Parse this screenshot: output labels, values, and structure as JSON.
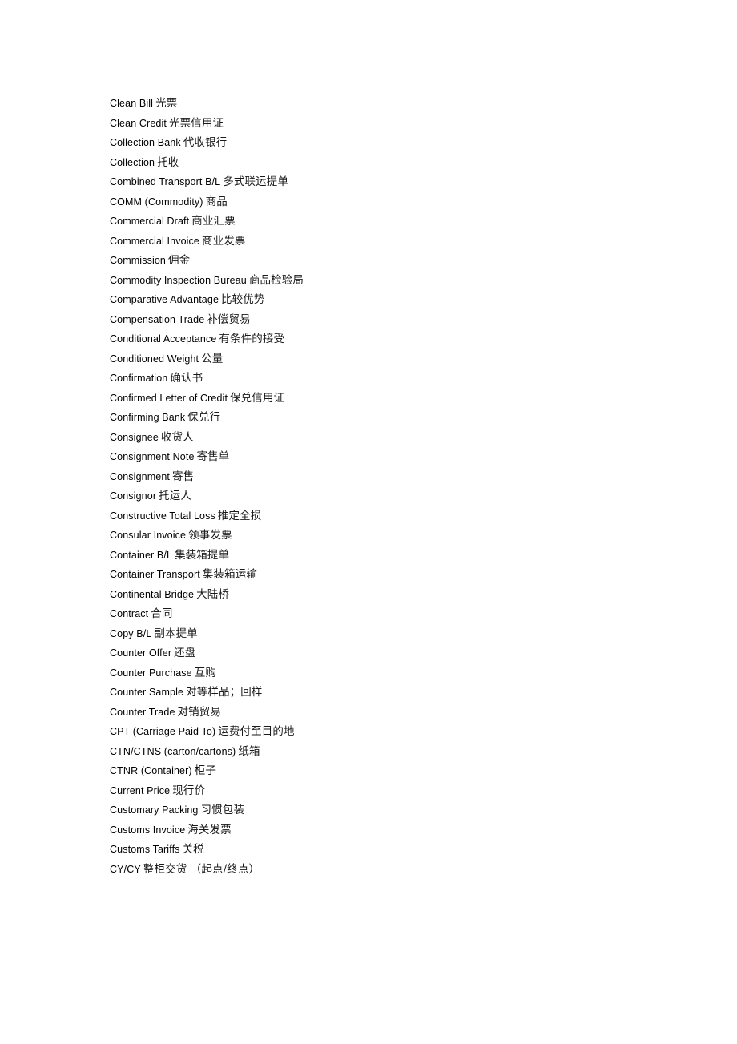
{
  "document": {
    "type": "glossary-page",
    "background_color": "#ffffff",
    "text_color": "#000000",
    "entries": [
      {
        "en": "Clean Bill",
        "zh": "光票"
      },
      {
        "en": "Clean Credit",
        "zh": "光票信用证"
      },
      {
        "en": "Collection Bank",
        "zh": "代收银行"
      },
      {
        "en": "Collection",
        "zh": "托收"
      },
      {
        "en": "Combined Transport B/L",
        "zh": "多式联运提单"
      },
      {
        "en": "COMM (Commodity)",
        "zh": "商品"
      },
      {
        "en": "Commercial Draft",
        "zh": "商业汇票"
      },
      {
        "en": "Commercial Invoice",
        "zh": "商业发票"
      },
      {
        "en": "Commission",
        "zh": "佣金"
      },
      {
        "en": "Commodity Inspection Bureau",
        "zh": "商品检验局"
      },
      {
        "en": "Comparative Advantage",
        "zh": "比较优势"
      },
      {
        "en": "Compensation Trade",
        "zh": "补偿贸易"
      },
      {
        "en": "Conditional Acceptance",
        "zh": "有条件的接受"
      },
      {
        "en": "Conditioned Weight",
        "zh": "公量"
      },
      {
        "en": "Confirmation",
        "zh": "确认书"
      },
      {
        "en": "Confirmed Letter of Credit",
        "zh": "保兑信用证"
      },
      {
        "en": "Confirming Bank",
        "zh": "保兑行"
      },
      {
        "en": "Consignee",
        "zh": "收货人"
      },
      {
        "en": "Consignment Note",
        "zh": "寄售单"
      },
      {
        "en": "Consignment",
        "zh": "寄售"
      },
      {
        "en": "Consignor",
        "zh": "托运人"
      },
      {
        "en": "Constructive Total Loss",
        "zh": "推定全损"
      },
      {
        "en": "Consular Invoice",
        "zh": "领事发票"
      },
      {
        "en": "Container B/L",
        "zh": "集装箱提单"
      },
      {
        "en": "Container Transport",
        "zh": "集装箱运输"
      },
      {
        "en": "Continental Bridge",
        "zh": "大陆桥"
      },
      {
        "en": "Contract",
        "zh": "合同"
      },
      {
        "en": "Copy B/L",
        "zh": "副本提单"
      },
      {
        "en": "Counter Offer",
        "zh": "还盘"
      },
      {
        "en": "Counter Purchase",
        "zh": "互购"
      },
      {
        "en": "Counter Sample",
        "zh": "对等样品；回样"
      },
      {
        "en": "Counter Trade",
        "zh": "对销贸易"
      },
      {
        "en": "CPT (Carriage Paid To)",
        "zh": "运费付至目的地"
      },
      {
        "en": "CTN/CTNS (carton/cartons)",
        "zh": "纸箱"
      },
      {
        "en": "CTNR (Container)",
        "zh": "柜子"
      },
      {
        "en": "Current Price",
        "zh": "现行价"
      },
      {
        "en": "Customary Packing",
        "zh": "习惯包装"
      },
      {
        "en": "Customs Invoice",
        "zh": "海关发票"
      },
      {
        "en": "Customs Tariffs",
        "zh": "关税"
      },
      {
        "en": "CY/CY",
        "zh": "整柜交货 （起点/终点）"
      }
    ]
  }
}
